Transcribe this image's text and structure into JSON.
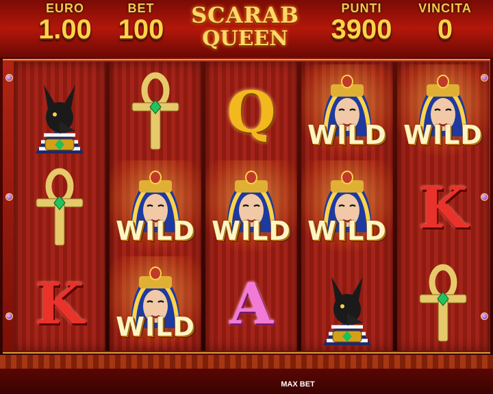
{
  "hud": {
    "euro_label": "EURO",
    "euro_value": "1.00",
    "bet_label": "BET",
    "bet_value": "100",
    "punti_label": "PUNTI",
    "punti_value": "3900",
    "vincita_label": "VINCITA",
    "vincita_value": "0"
  },
  "logo": {
    "line1": "SCARAB",
    "line2": "QUEEN"
  },
  "reels": [
    [
      "anubis",
      "ankh",
      "K"
    ],
    [
      "ankh",
      "wild",
      "wild"
    ],
    [
      "Q",
      "wild",
      "A"
    ],
    [
      "wild",
      "wild",
      "anubis"
    ],
    [
      "wild",
      "K",
      "ankh"
    ]
  ],
  "wild_label": "WILD",
  "letters": {
    "q": "Q",
    "k": "K",
    "a": "A"
  },
  "footer": {
    "max_bet_label": "MAX BET"
  },
  "colors": {
    "gold": "#ffd24a",
    "reel_red": "#a3241a",
    "wild_glow": "#ffd25a"
  }
}
